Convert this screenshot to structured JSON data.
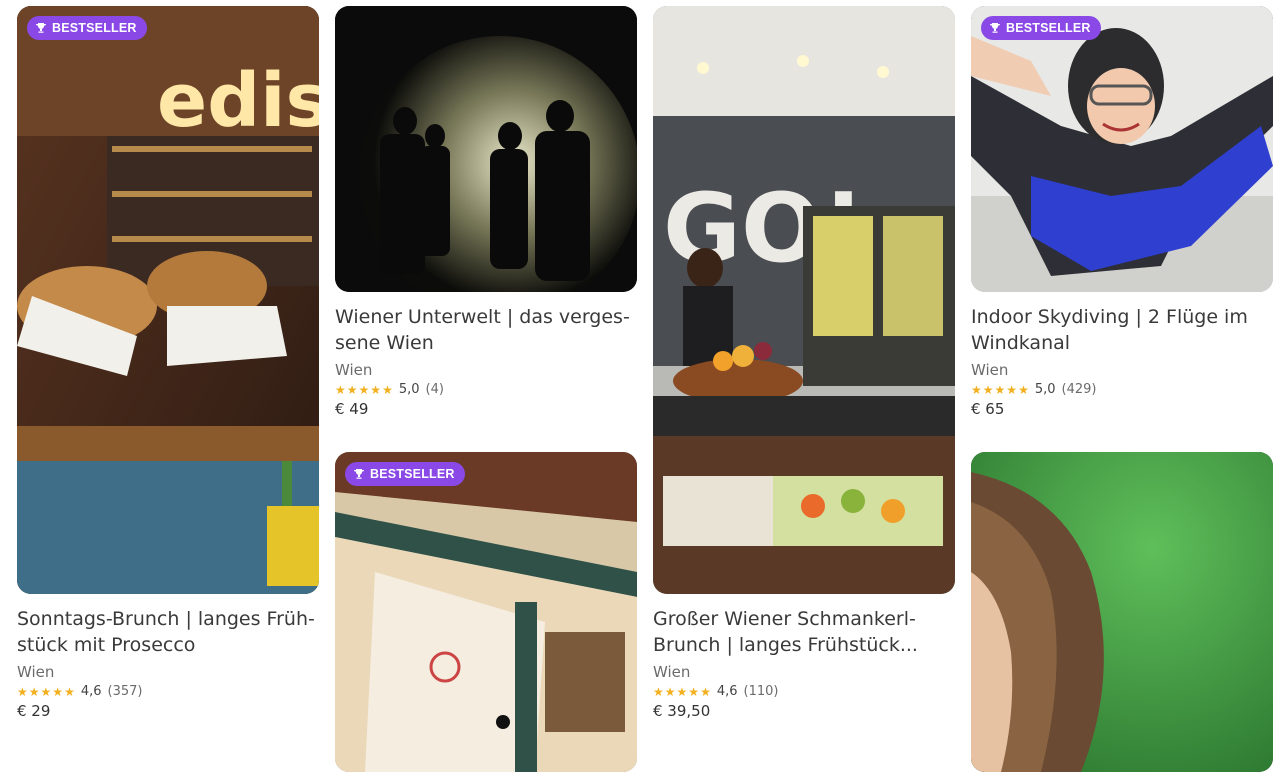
{
  "cards": [
    {
      "badge": "BESTSELLER",
      "title": "Sonntags-Brunch | langes Früh-stück mit Prosecco",
      "location": "Wien",
      "rating": "4,6",
      "reviews": "(357)",
      "stars": 4.6,
      "price": "€ 29",
      "image": "edison-bar-brunch"
    },
    {
      "title": "Wiener Unterwelt | das verges-sene Wien",
      "location": "Wien",
      "rating": "5,0",
      "reviews": "(4)",
      "stars": 5,
      "price": "€ 49",
      "image": "tunnel-silhouettes"
    },
    {
      "title": "Großer Wiener Schmankerl-Brunch | langes Frühstück...",
      "location": "Wien",
      "rating": "4,6",
      "reviews": "(110)",
      "stars": 4.6,
      "price": "€ 39,50",
      "image": "go-wien-buffet"
    },
    {
      "badge": "BESTSELLER",
      "title": "Indoor Skydiving | 2 Flüge im Windkanal",
      "location": "Wien",
      "rating": "5,0",
      "reviews": "(429)",
      "stars": 5,
      "price": "€ 65",
      "image": "indoor-skydiver"
    },
    {
      "badge": "BESTSELLER",
      "image": "street-window"
    },
    {
      "image": "hair-green-background"
    }
  ],
  "colors": {
    "badge": "#8a49e6",
    "star": "#f2b01e"
  },
  "icons": {
    "badge": "trophy-icon",
    "star": "star-icon"
  }
}
